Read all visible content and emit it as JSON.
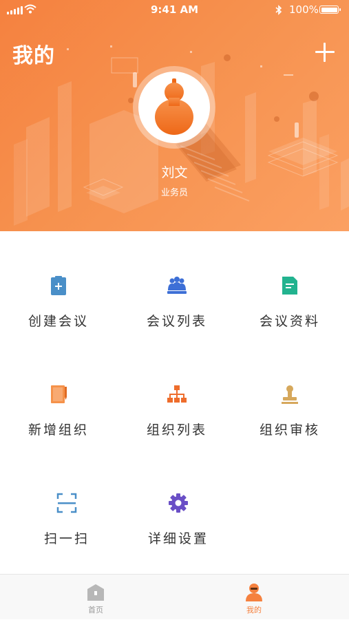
{
  "status_bar": {
    "time": "9:41 AM",
    "battery": "100%"
  },
  "header": {
    "title": "我的"
  },
  "profile": {
    "name": "刘文",
    "role": "业务员"
  },
  "menu": [
    {
      "label": "创建会议",
      "icon": "clipboard-add-icon",
      "color": "#4a8fc8"
    },
    {
      "label": "会议列表",
      "icon": "group-icon",
      "color": "#3d6fd6"
    },
    {
      "label": "会议资料",
      "icon": "document-icon",
      "color": "#22b38f"
    },
    {
      "label": "新增组织",
      "icon": "book-edit-icon",
      "color": "#f5924a"
    },
    {
      "label": "组织列表",
      "icon": "org-chart-icon",
      "color": "#ee6d2c"
    },
    {
      "label": "组织审核",
      "icon": "stamp-icon",
      "color": "#d6a85c"
    },
    {
      "label": "扫一扫",
      "icon": "scan-icon",
      "color": "#4a8fc8"
    },
    {
      "label": "详细设置",
      "icon": "gear-icon",
      "color": "#6a4fc6"
    }
  ],
  "tabbar": {
    "home": {
      "label": "首页",
      "icon": "home-icon",
      "color": "#b7b7b7"
    },
    "mine": {
      "label": "我的",
      "icon": "user-icon",
      "color": "#f5813f"
    }
  },
  "colors": {
    "accent": "#f5813f",
    "text": "#333333"
  }
}
